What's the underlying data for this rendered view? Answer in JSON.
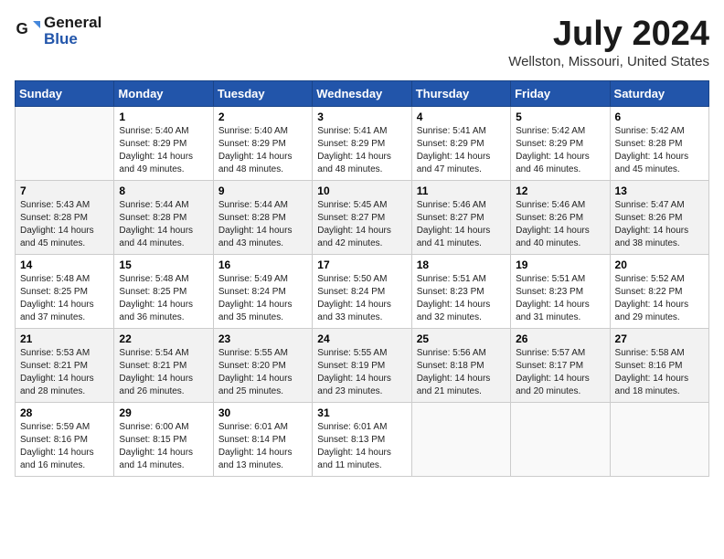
{
  "logo": {
    "general": "General",
    "blue": "Blue"
  },
  "title": "July 2024",
  "subtitle": "Wellston, Missouri, United States",
  "weekdays": [
    "Sunday",
    "Monday",
    "Tuesday",
    "Wednesday",
    "Thursday",
    "Friday",
    "Saturday"
  ],
  "weeks": [
    [
      {
        "day": "",
        "info": ""
      },
      {
        "day": "1",
        "info": "Sunrise: 5:40 AM\nSunset: 8:29 PM\nDaylight: 14 hours\nand 49 minutes."
      },
      {
        "day": "2",
        "info": "Sunrise: 5:40 AM\nSunset: 8:29 PM\nDaylight: 14 hours\nand 48 minutes."
      },
      {
        "day": "3",
        "info": "Sunrise: 5:41 AM\nSunset: 8:29 PM\nDaylight: 14 hours\nand 48 minutes."
      },
      {
        "day": "4",
        "info": "Sunrise: 5:41 AM\nSunset: 8:29 PM\nDaylight: 14 hours\nand 47 minutes."
      },
      {
        "day": "5",
        "info": "Sunrise: 5:42 AM\nSunset: 8:29 PM\nDaylight: 14 hours\nand 46 minutes."
      },
      {
        "day": "6",
        "info": "Sunrise: 5:42 AM\nSunset: 8:28 PM\nDaylight: 14 hours\nand 45 minutes."
      }
    ],
    [
      {
        "day": "7",
        "info": "Sunrise: 5:43 AM\nSunset: 8:28 PM\nDaylight: 14 hours\nand 45 minutes."
      },
      {
        "day": "8",
        "info": "Sunrise: 5:44 AM\nSunset: 8:28 PM\nDaylight: 14 hours\nand 44 minutes."
      },
      {
        "day": "9",
        "info": "Sunrise: 5:44 AM\nSunset: 8:28 PM\nDaylight: 14 hours\nand 43 minutes."
      },
      {
        "day": "10",
        "info": "Sunrise: 5:45 AM\nSunset: 8:27 PM\nDaylight: 14 hours\nand 42 minutes."
      },
      {
        "day": "11",
        "info": "Sunrise: 5:46 AM\nSunset: 8:27 PM\nDaylight: 14 hours\nand 41 minutes."
      },
      {
        "day": "12",
        "info": "Sunrise: 5:46 AM\nSunset: 8:26 PM\nDaylight: 14 hours\nand 40 minutes."
      },
      {
        "day": "13",
        "info": "Sunrise: 5:47 AM\nSunset: 8:26 PM\nDaylight: 14 hours\nand 38 minutes."
      }
    ],
    [
      {
        "day": "14",
        "info": "Sunrise: 5:48 AM\nSunset: 8:25 PM\nDaylight: 14 hours\nand 37 minutes."
      },
      {
        "day": "15",
        "info": "Sunrise: 5:48 AM\nSunset: 8:25 PM\nDaylight: 14 hours\nand 36 minutes."
      },
      {
        "day": "16",
        "info": "Sunrise: 5:49 AM\nSunset: 8:24 PM\nDaylight: 14 hours\nand 35 minutes."
      },
      {
        "day": "17",
        "info": "Sunrise: 5:50 AM\nSunset: 8:24 PM\nDaylight: 14 hours\nand 33 minutes."
      },
      {
        "day": "18",
        "info": "Sunrise: 5:51 AM\nSunset: 8:23 PM\nDaylight: 14 hours\nand 32 minutes."
      },
      {
        "day": "19",
        "info": "Sunrise: 5:51 AM\nSunset: 8:23 PM\nDaylight: 14 hours\nand 31 minutes."
      },
      {
        "day": "20",
        "info": "Sunrise: 5:52 AM\nSunset: 8:22 PM\nDaylight: 14 hours\nand 29 minutes."
      }
    ],
    [
      {
        "day": "21",
        "info": "Sunrise: 5:53 AM\nSunset: 8:21 PM\nDaylight: 14 hours\nand 28 minutes."
      },
      {
        "day": "22",
        "info": "Sunrise: 5:54 AM\nSunset: 8:21 PM\nDaylight: 14 hours\nand 26 minutes."
      },
      {
        "day": "23",
        "info": "Sunrise: 5:55 AM\nSunset: 8:20 PM\nDaylight: 14 hours\nand 25 minutes."
      },
      {
        "day": "24",
        "info": "Sunrise: 5:55 AM\nSunset: 8:19 PM\nDaylight: 14 hours\nand 23 minutes."
      },
      {
        "day": "25",
        "info": "Sunrise: 5:56 AM\nSunset: 8:18 PM\nDaylight: 14 hours\nand 21 minutes."
      },
      {
        "day": "26",
        "info": "Sunrise: 5:57 AM\nSunset: 8:17 PM\nDaylight: 14 hours\nand 20 minutes."
      },
      {
        "day": "27",
        "info": "Sunrise: 5:58 AM\nSunset: 8:16 PM\nDaylight: 14 hours\nand 18 minutes."
      }
    ],
    [
      {
        "day": "28",
        "info": "Sunrise: 5:59 AM\nSunset: 8:16 PM\nDaylight: 14 hours\nand 16 minutes."
      },
      {
        "day": "29",
        "info": "Sunrise: 6:00 AM\nSunset: 8:15 PM\nDaylight: 14 hours\nand 14 minutes."
      },
      {
        "day": "30",
        "info": "Sunrise: 6:01 AM\nSunset: 8:14 PM\nDaylight: 14 hours\nand 13 minutes."
      },
      {
        "day": "31",
        "info": "Sunrise: 6:01 AM\nSunset: 8:13 PM\nDaylight: 14 hours\nand 11 minutes."
      },
      {
        "day": "",
        "info": ""
      },
      {
        "day": "",
        "info": ""
      },
      {
        "day": "",
        "info": ""
      }
    ]
  ]
}
